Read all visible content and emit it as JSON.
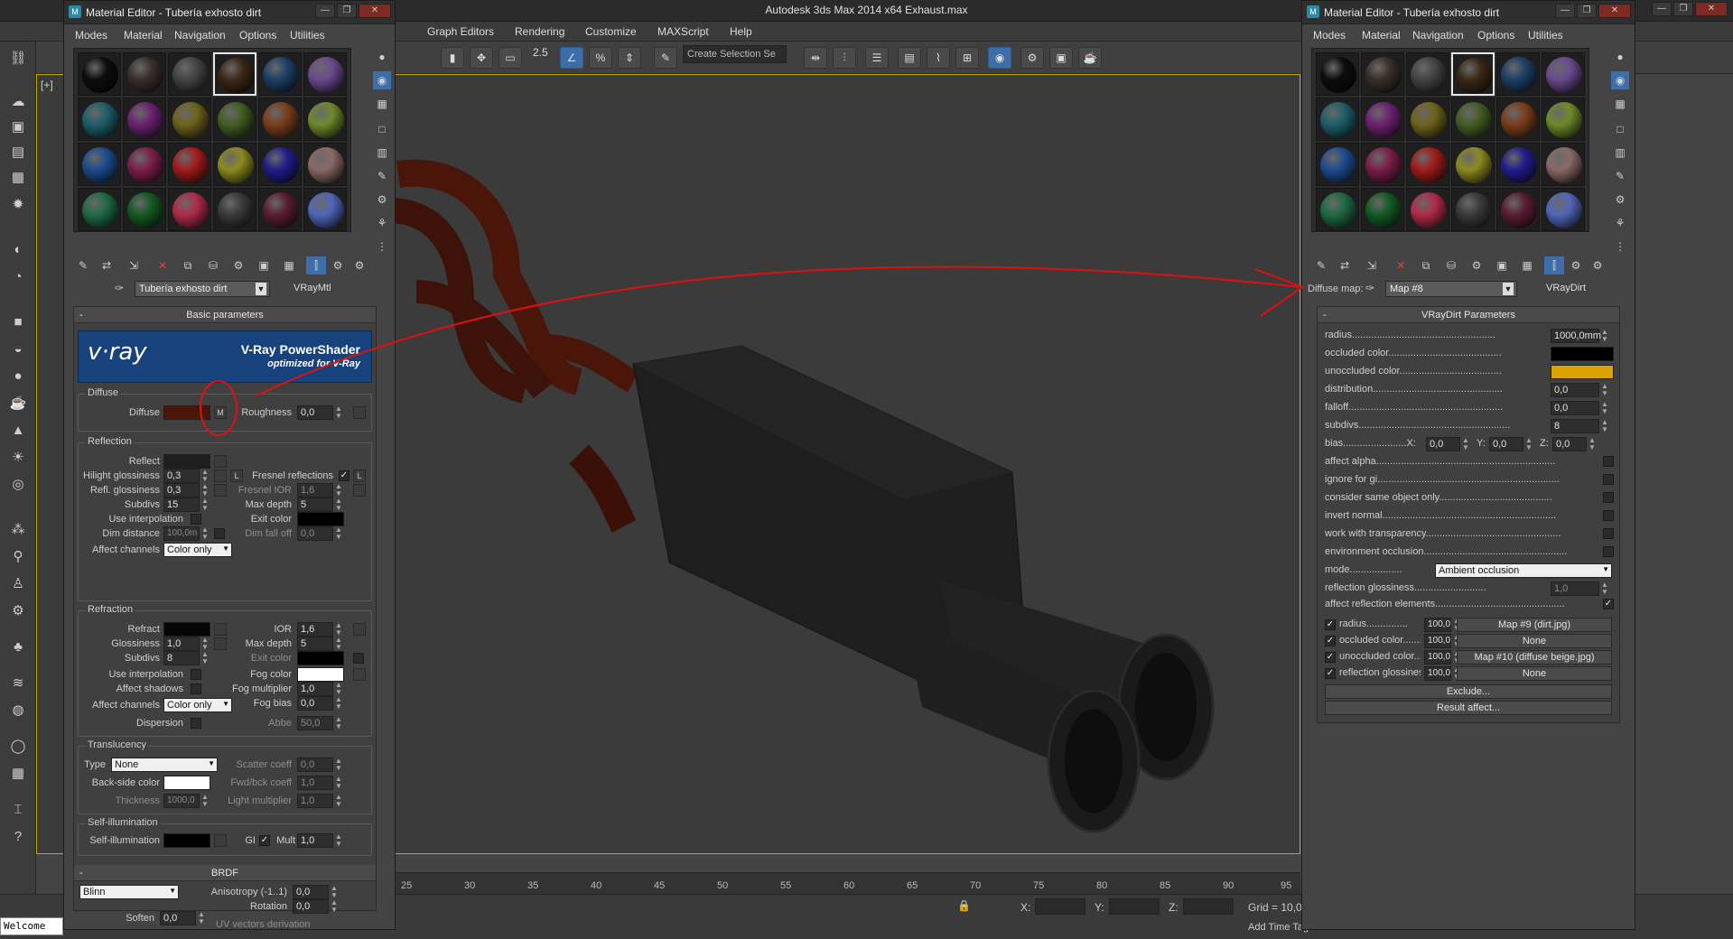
{
  "app": {
    "title": "Autodesk 3ds Max  2014 x64     Exhaust.max",
    "menus": [
      "Graph Editors",
      "Rendering",
      "Customize",
      "MAXScript",
      "Help"
    ],
    "toolbar": {
      "spinner_label": "2.5",
      "selection_set_placeholder": "Create Selection Se"
    },
    "viewport_label": "[+]",
    "timeline_ticks": [
      "25",
      "30",
      "35",
      "40",
      "45",
      "50",
      "55",
      "60",
      "65",
      "70",
      "75",
      "80",
      "85",
      "90",
      "95"
    ],
    "status": {
      "x_label": "X:",
      "y_label": "Y:",
      "z_label": "Z:",
      "grid": "Grid = 10,0",
      "add_time_tag": "Add Time Tag",
      "welcome": "Welcome"
    }
  },
  "left_editor": {
    "title": "Material Editor - Tubería exhosto dirt",
    "menus": [
      "Modes",
      "Material",
      "Navigation",
      "Options",
      "Utilities"
    ],
    "material_name": "Tubería exhosto dirt",
    "material_type": "VRayMtl",
    "basic_params_header": "Basic parameters",
    "vray": {
      "logo": "v·ray",
      "title": "V-Ray PowerShader",
      "subtitle": "optimized for V-Ray"
    },
    "diffuse": {
      "group": "Diffuse",
      "label": "Diffuse",
      "map_btn": "M",
      "roughness_label": "Roughness",
      "roughness": "0,0"
    },
    "reflection": {
      "group": "Reflection",
      "reflect_label": "Reflect",
      "hilight_label": "Hilight glossiness",
      "hilight": "0,3",
      "l_btn": "L",
      "fresnel_label": "Fresnel reflections",
      "fresnel_checked": "✓",
      "fresnel_l": "L",
      "refl_gloss_label": "Refl. glossiness",
      "refl_gloss": "0,3",
      "fresnel_ior_label": "Fresnel IOR",
      "fresnel_ior": "1,6",
      "subdivs_label": "Subdivs",
      "subdivs": "15",
      "max_depth_label": "Max depth",
      "max_depth": "5",
      "use_interp_label": "Use interpolation",
      "exit_color_label": "Exit color",
      "dim_dist_label": "Dim distance",
      "dim_dist": "100,0m",
      "dim_falloff_label": "Dim fall off",
      "dim_falloff": "0,0",
      "affect_channels_label": "Affect channels",
      "affect_channels": "Color only"
    },
    "refraction": {
      "group": "Refraction",
      "refract_label": "Refract",
      "ior_label": "IOR",
      "ior": "1,6",
      "gloss_label": "Glossiness",
      "gloss": "1,0",
      "max_depth_label": "Max depth",
      "max_depth": "5",
      "subdivs_label": "Subdivs",
      "subdivs": "8",
      "exit_color_label": "Exit color",
      "use_interp_label": "Use interpolation",
      "fog_color_label": "Fog color",
      "affect_shadows_label": "Affect shadows",
      "fog_mult_label": "Fog multiplier",
      "fog_mult": "1,0",
      "affect_channels_label": "Affect channels",
      "affect_channels": "Color only",
      "fog_bias_label": "Fog bias",
      "fog_bias": "0,0",
      "dispersion_label": "Dispersion",
      "abbe_label": "Abbe",
      "abbe": "50,0"
    },
    "translucency": {
      "group": "Translucency",
      "type_label": "Type",
      "type": "None",
      "scatter_label": "Scatter coeff",
      "scatter": "0,0",
      "backside_label": "Back-side color",
      "fwdbck_label": "Fwd/bck coeff",
      "fwdbck": "1,0",
      "thickness_label": "Thickness",
      "thickness": "1000,0",
      "light_mult_label": "Light multiplier",
      "light_mult": "1,0"
    },
    "selfillum": {
      "group": "Self-illumination",
      "label": "Self-illumination",
      "gi_label": "GI",
      "gi_checked": "✓",
      "mult_label": "Mult",
      "mult": "1,0"
    },
    "brdf": {
      "header": "BRDF",
      "type": "Blinn",
      "aniso_label": "Anisotropy (-1..1)",
      "aniso": "0,0",
      "rotation_label": "Rotation",
      "rotation": "0,0",
      "soften_label": "Soften",
      "soften": "0,0",
      "uv_label": "UV vectors derivation"
    }
  },
  "right_editor": {
    "title": "Material Editor - Tubería exhosto dirt",
    "menus": [
      "Modes",
      "Material",
      "Navigation",
      "Options",
      "Utilities"
    ],
    "slot_label": "Diffuse map:",
    "map_name": "Map #8",
    "map_type": "VRayDirt",
    "params_header": "VRayDirt Parameters",
    "radius_label": "radius....................................................",
    "radius": "1000,0mm",
    "occluded_label": "occluded color.........................................",
    "unoccluded_label": "unoccluded color.....................................",
    "distribution_label": "distribution...............................................",
    "distribution": "0,0",
    "falloff_label": "falloff........................................................",
    "falloff": "0,0",
    "subdivs_label": "subdivs.......................................................",
    "subdivs": "8",
    "bias_label": "bias.......................X:",
    "bias_x": "0,0",
    "bias_y_label": "Y:",
    "bias_y": "0,0",
    "bias_z_label": "Z:",
    "bias_z": "0,0",
    "affect_alpha_label": "affect alpha.................................................................",
    "ignore_gi_label": "ignore for gi..................................................................",
    "same_object_label": "consider same object only.........................................",
    "invert_normal_label": "invert normal...............................................................",
    "work_transp_label": "work with transparency.................................................",
    "env_occl_label": "environment occlusion....................................................",
    "mode_label": "mode...................",
    "mode": "Ambient occlusion",
    "refl_gloss_label": "reflection glossiness..........................",
    "refl_gloss": "1,0",
    "affect_refl_label": "affect reflection elements...............................................",
    "affect_refl_checked": "✓",
    "maps": [
      {
        "label": "radius...............",
        "amount": "100,0",
        "map": "Map #9 (dirt.jpg)"
      },
      {
        "label": "occluded color.......",
        "amount": "100,0",
        "map": "None"
      },
      {
        "label": "unoccluded color.....",
        "amount": "100,0",
        "map": "Map #10 (diffuse beige.jpg)"
      },
      {
        "label": "reflection glossiness",
        "amount": "100,0",
        "map": "None"
      }
    ],
    "map_checked": "✓",
    "exclude": "Exclude...",
    "result_affect": "Result affect..."
  },
  "colors": {
    "diffuse_swatch": "#4a1608",
    "unoccluded_swatch": "#d9a400",
    "annotation_red": "#e01010",
    "accent": "#3d6ea8"
  },
  "slot_balls": [
    [
      "#0d0d0d",
      "#3a2f2a",
      "#444",
      "#3b2716",
      "#1d3f66",
      "#6b4a8f"
    ],
    [
      "#1e5f6a",
      "#6b2270",
      "#6e641c",
      "#435e24",
      "#7a3e1c",
      "#6e8a2a"
    ],
    [
      "#1e4b8e",
      "#7b1f4a",
      "#a21b1b",
      "#8c8a20",
      "#221d8c",
      "#8a6a66"
    ],
    [
      "#1f6a44",
      "#145a22",
      "#b02a48",
      "#3a3a3a",
      "#5a1d34",
      "#5066b8"
    ]
  ]
}
